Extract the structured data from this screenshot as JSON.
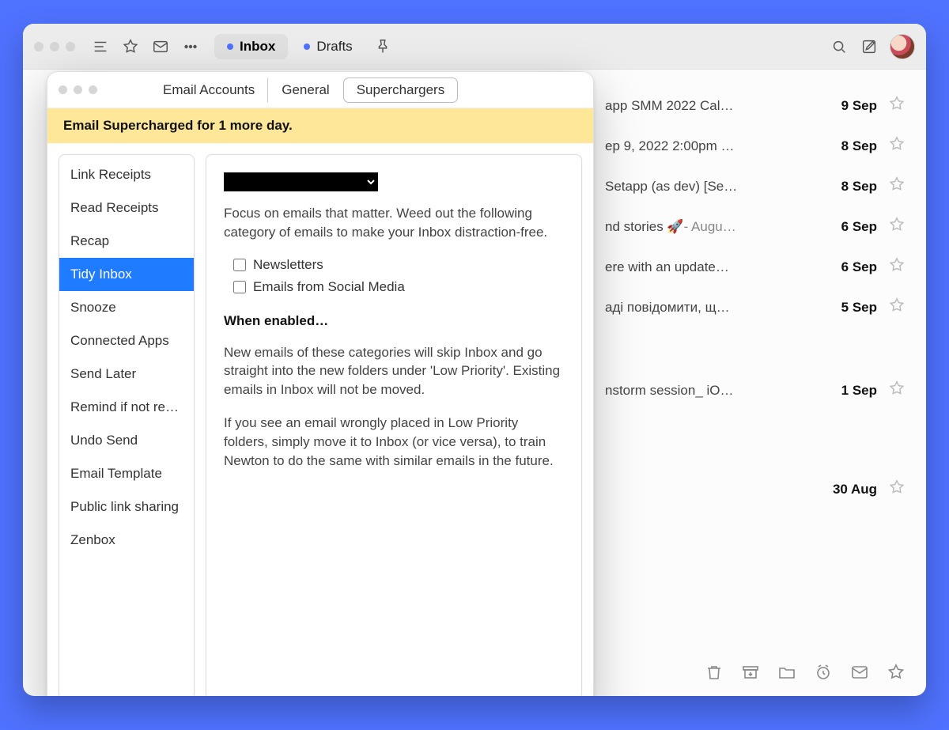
{
  "toolbar": {
    "tabs": [
      {
        "label": "Inbox",
        "active": true
      },
      {
        "label": "Drafts",
        "active": false
      }
    ]
  },
  "prefs": {
    "segments": {
      "email_accounts": "Email Accounts",
      "general": "General",
      "superchargers": "Superchargers"
    },
    "banner": "Email Supercharged for 1 more day.",
    "side_items": [
      "Link Receipts",
      "Read Receipts",
      "Recap",
      "Tidy Inbox",
      "Snooze",
      "Connected Apps",
      "Send Later",
      "Remind if not re…",
      "Undo Send",
      "Email Template",
      "Public link sharing",
      "Zenbox"
    ],
    "content": {
      "focus_text": "Focus on emails that matter. Weed out the following category of emails to make your Inbox distraction-free.",
      "opt_newsletters": "Newsletters",
      "opt_social": "Emails from Social Media",
      "when_enabled": "When enabled…",
      "para1": "New emails of these categories will skip Inbox and go straight into the new folders under 'Low Priority'. Existing emails in Inbox will not be moved.",
      "para2": "If you see an email wrongly placed in Low Priority folders, simply move it to Inbox (or vice versa), to train Newton to do the same with similar emails in the future."
    }
  },
  "messages": [
    {
      "subject": "app SMM 2022 Cal…",
      "date": "9 Sep",
      "gray": false
    },
    {
      "subject": "ep 9, 2022 2:00pm …",
      "date": "8 Sep",
      "gray": false
    },
    {
      "subject": "Setapp (as dev) [Se…",
      "date": "8 Sep",
      "gray": false
    },
    {
      "subject": "nd stories 🚀",
      "trail": "- Augu…",
      "date": "6 Sep",
      "gray": true
    },
    {
      "subject": "ere with an update…",
      "date": "6 Sep",
      "gray": false
    },
    {
      "subject": "аді повідомити, щ…",
      "date": "5 Sep",
      "gray": false
    },
    {
      "subject": "nstorm session_ iO…",
      "date": "1 Sep",
      "gray": false
    },
    {
      "subject": "",
      "date": "30 Aug",
      "gray": false
    }
  ]
}
